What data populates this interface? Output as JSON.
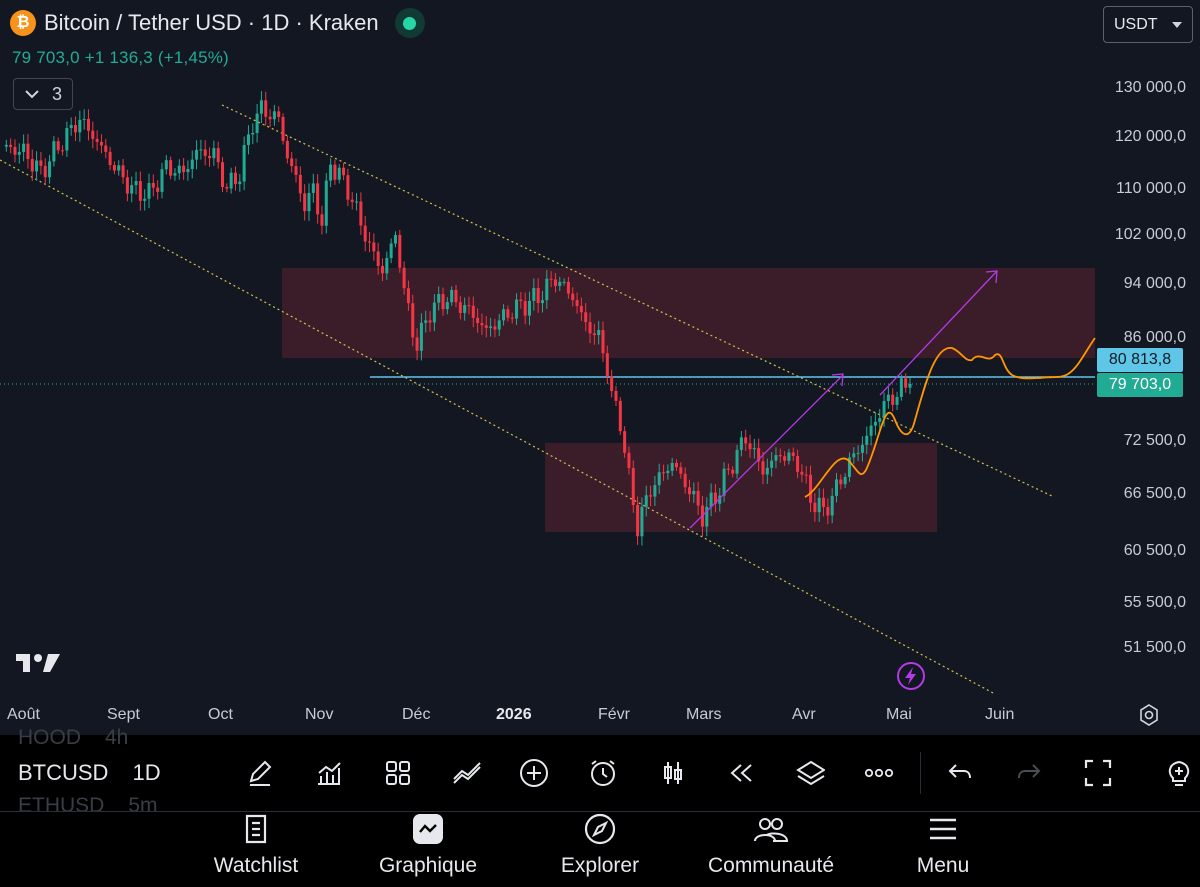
{
  "header": {
    "coin_symbol": "₿",
    "title": "Bitcoin / Tether USD · 1D · Kraken",
    "price_change": "79 703,0  +1 136,3 (+1,45%)",
    "indicator_count": "3",
    "currency": "USDT"
  },
  "y_axis": [
    "130 000,0",
    "120 000,0",
    "110 000,0",
    "102 000,0",
    "94 000,0",
    "86 000,0",
    "72 500,0",
    "66 500,0",
    "60 500,0",
    "55 500,0",
    "51 500,0"
  ],
  "price_tags": {
    "level": "80 813,8",
    "last": "79 703,0"
  },
  "x_axis": [
    "Août",
    "Sept",
    "Oct",
    "Nov",
    "Déc",
    "2026",
    "Févr",
    "Mars",
    "Avr",
    "Mai",
    "Juin"
  ],
  "toolbar": {
    "symbol_above": "HOOD",
    "interval_above": "4h",
    "symbol": "BTCUSD",
    "interval": "1D",
    "symbol_below": "ETHUSD",
    "interval_below": "5m"
  },
  "nav": [
    "Watchlist",
    "Graphique",
    "Explorer",
    "Communauté",
    "Menu"
  ],
  "colors": {
    "up": "#22ab94",
    "down": "#f23645",
    "background": "#131722",
    "projection": "#ff9800",
    "arrow": "#b23be6",
    "level_line": "#5fc6e8",
    "zone": "#4a1f2c"
  },
  "chart_data": {
    "type": "candlestick",
    "symbol": "Bitcoin / Tether USD",
    "interval": "1D",
    "exchange": "Kraken",
    "x_ticks": [
      "Août",
      "Sept",
      "Oct",
      "Nov",
      "Déc",
      "2026",
      "Févr",
      "Mars",
      "Avr",
      "Mai",
      "Juin"
    ],
    "y_ticks": [
      130000,
      120000,
      110000,
      102000,
      94000,
      86000,
      72500,
      66500,
      60500,
      55500,
      51500
    ],
    "last_price": 79703.0,
    "change": 1136.3,
    "change_pct": 1.45,
    "level_line": 80813.8,
    "ohlc_path": [
      [
        0,
        118000
      ],
      [
        5,
        117000
      ],
      [
        9,
        113000
      ],
      [
        13,
        118000
      ],
      [
        18,
        123500
      ],
      [
        22,
        119000
      ],
      [
        26,
        114000
      ],
      [
        30,
        110000
      ],
      [
        34,
        109000
      ],
      [
        38,
        114000
      ],
      [
        42,
        113000
      ],
      [
        45,
        117000
      ],
      [
        49,
        116500
      ],
      [
        52,
        110000
      ],
      [
        55,
        113000
      ],
      [
        58,
        123000
      ],
      [
        60,
        125500
      ],
      [
        64,
        123500
      ],
      [
        66,
        116000
      ],
      [
        68,
        112000
      ],
      [
        70,
        107000
      ],
      [
        72,
        110000
      ],
      [
        74,
        104000
      ],
      [
        76,
        115000
      ],
      [
        80,
        110000
      ],
      [
        82,
        106000
      ],
      [
        85,
        100000
      ],
      [
        88,
        96000
      ],
      [
        91,
        102000
      ],
      [
        93,
        93000
      ],
      [
        95,
        87000
      ],
      [
        96,
        85000
      ],
      [
        99,
        90000
      ],
      [
        103,
        92000
      ],
      [
        108,
        90000
      ],
      [
        112,
        87000
      ],
      [
        118,
        90000
      ],
      [
        124,
        92000
      ],
      [
        128,
        95000
      ],
      [
        132,
        92000
      ],
      [
        135,
        88000
      ],
      [
        138,
        86000
      ],
      [
        140,
        82000
      ],
      [
        141,
        78000
      ],
      [
        143,
        75000
      ],
      [
        145,
        68000
      ],
      [
        147,
        63000
      ],
      [
        150,
        67000
      ],
      [
        155,
        70000
      ],
      [
        160,
        66000
      ],
      [
        162,
        64000
      ],
      [
        166,
        67000
      ],
      [
        169,
        70000
      ],
      [
        172,
        73000
      ],
      [
        176,
        69000
      ],
      [
        180,
        71000
      ],
      [
        184,
        70000
      ],
      [
        187,
        66000
      ],
      [
        190,
        64500
      ],
      [
        193,
        67000
      ],
      [
        196,
        70000
      ],
      [
        200,
        73000
      ],
      [
        204,
        77000
      ],
      [
        208,
        79000
      ],
      [
        210,
        79703
      ]
    ],
    "annotations": {
      "channel": "falling channel (dotted)",
      "zones": [
        {
          "from": 85000,
          "to": 97000
        },
        {
          "from": 63000,
          "to": 74000
        }
      ],
      "projection": "orange projected path",
      "arrows": "two purple upward arrows"
    }
  }
}
